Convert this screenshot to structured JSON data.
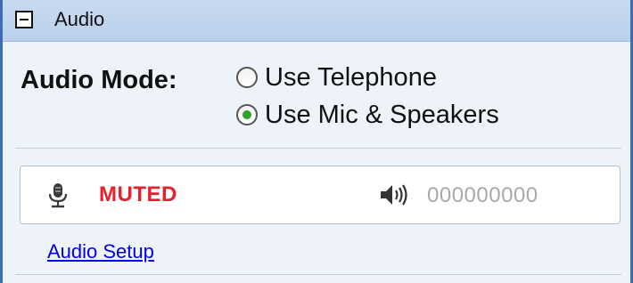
{
  "header": {
    "title": "Audio",
    "collapse_icon": "minus-box-icon"
  },
  "audio_mode": {
    "label": "Audio Mode:",
    "options": [
      {
        "label": "Use Telephone",
        "selected": false
      },
      {
        "label": "Use Mic & Speakers",
        "selected": true
      }
    ]
  },
  "status": {
    "mic_icon": "microphone-icon",
    "mic_state": "MUTED",
    "mic_state_color": "#e8202a",
    "speaker_icon": "speaker-icon",
    "speaker_level": "000000000"
  },
  "links": {
    "audio_setup": "Audio Setup"
  },
  "colors": {
    "panel_border": "#3a6fb5",
    "header_bg": "#c9daf0",
    "radio_selected": "#2aa52a",
    "link": "#0000ee"
  }
}
